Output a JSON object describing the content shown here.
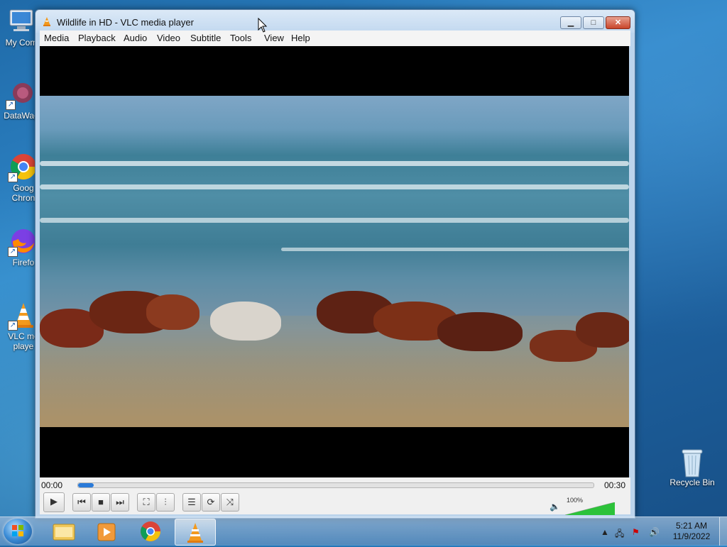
{
  "desktop": {
    "icons": [
      {
        "label": "My Com",
        "icon": "computer-icon"
      },
      {
        "label": "DataWag",
        "icon": "datawag-icon"
      },
      {
        "label": "Goog",
        "label2": "Chron",
        "icon": "chrome-icon"
      },
      {
        "label": "Firefo",
        "icon": "firefox-icon"
      },
      {
        "label": "VLC me",
        "label2": "playe",
        "icon": "vlc-icon"
      },
      {
        "label": "Recycle Bin",
        "icon": "recycle-bin-icon"
      }
    ]
  },
  "window": {
    "title": "Wildlife in HD - VLC media player",
    "menu": [
      "Media",
      "Playback",
      "Audio",
      "Video",
      "Subtitle",
      "Tools",
      "View",
      "Help"
    ],
    "controls": {
      "time_elapsed": "00:00",
      "time_total": "00:30",
      "progress": 0.03,
      "volume_label": "100%",
      "volume_level": 1.0
    },
    "colors": {
      "accent": "#2a7ad8",
      "volume": "#2cc23a",
      "close": "#c9452a"
    }
  },
  "taskbar": {
    "apps": [
      "windows-explorer-icon",
      "media-player-icon",
      "chrome-icon",
      "vlc-icon"
    ],
    "clock_time": "5:21 AM",
    "clock_date": "11/9/2022"
  }
}
